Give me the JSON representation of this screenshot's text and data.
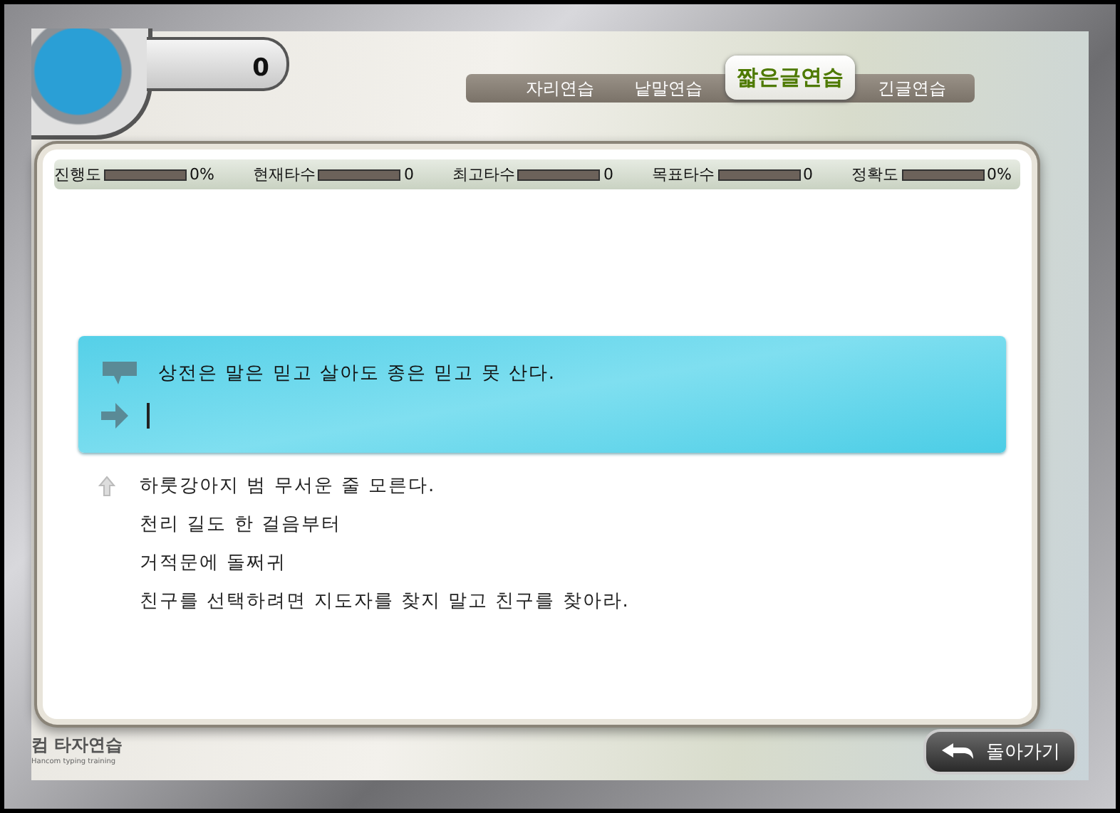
{
  "score": "0",
  "tabs": [
    {
      "label": "자리연습",
      "selected": false
    },
    {
      "label": "낱말연습",
      "selected": false
    },
    {
      "label": "짧은글연습",
      "selected": true
    },
    {
      "label": "긴글연습",
      "selected": false
    }
  ],
  "stats": [
    {
      "label": "진행도",
      "level": 0,
      "value": "0%"
    },
    {
      "label": "현재타수",
      "level": 0,
      "value": "0"
    },
    {
      "label": "최고타수",
      "level": 0,
      "value": "0"
    },
    {
      "label": "목표타수",
      "level": 0,
      "value": "0"
    },
    {
      "label": "정확도",
      "level": 0,
      "value": "0%"
    }
  ],
  "current": {
    "sentence": "상전은 말은 믿고 살아도 종은 믿고 못 산다."
  },
  "upcoming": [
    "하룻강아지 범 무서운 줄 모른다.",
    "천리 길도 한 걸음부터",
    "거적문에 돌쩌귀",
    "친구를 선택하려면 지도자를 찾지 말고 친구를 찾아라."
  ],
  "logo": {
    "title": "컴 타자연습",
    "subtitle": "Hancom typing training"
  },
  "back_button": "돌아가기"
}
